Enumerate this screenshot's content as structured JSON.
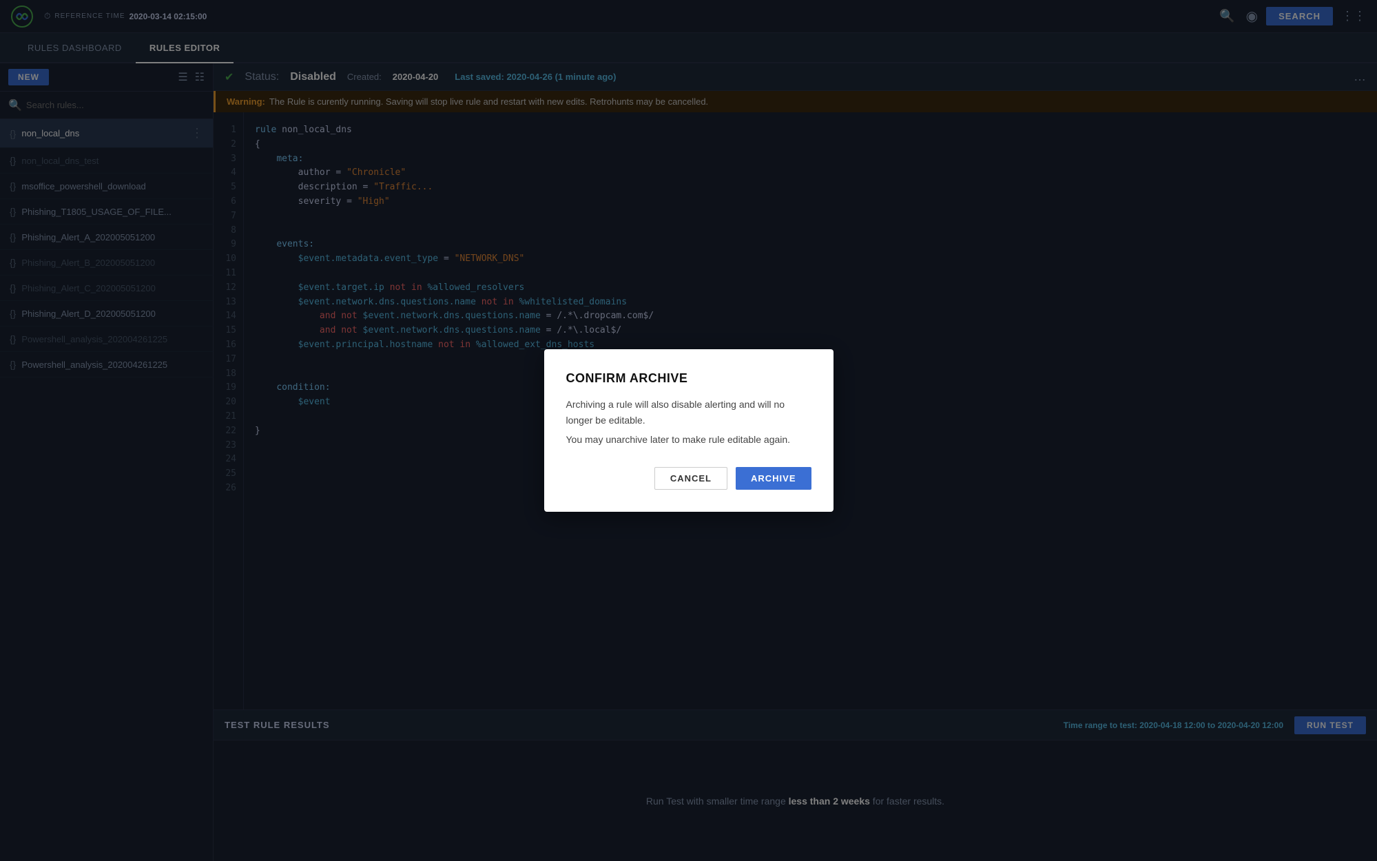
{
  "app": {
    "logo_alt": "Chronicle"
  },
  "topbar": {
    "ref_time_label": "REFERENCE TIME",
    "ref_time_value": "2020-03-14  02:15:00",
    "search_btn_label": "SEARCH"
  },
  "nav": {
    "tabs": [
      {
        "id": "rules-dashboard",
        "label": "RULES DASHBOARD",
        "active": false
      },
      {
        "id": "rules-editor",
        "label": "RULES EDITOR",
        "active": true
      }
    ]
  },
  "sidebar": {
    "new_btn": "NEW",
    "search_placeholder": "Search rules...",
    "rules": [
      {
        "id": "non_local_dns",
        "name": "non_local_dns",
        "active": true,
        "disabled": false,
        "type": "rule"
      },
      {
        "id": "non_local_dns_test",
        "name": "non_local_dns_test",
        "active": false,
        "disabled": true,
        "type": "rule"
      },
      {
        "id": "msoffice_powershell_download",
        "name": "msoffice_powershell_download",
        "active": false,
        "disabled": false,
        "type": "rule"
      },
      {
        "id": "phishing_t1805",
        "name": "Phishing_T1805_USAGE_OF_FILE...",
        "active": false,
        "disabled": false,
        "type": "rule"
      },
      {
        "id": "phishing_a",
        "name": "Phishing_Alert_A_202005051200",
        "active": false,
        "disabled": false,
        "type": "rule"
      },
      {
        "id": "phishing_b",
        "name": "Phishing_Alert_B_202005051200",
        "active": false,
        "disabled": true,
        "type": "rule"
      },
      {
        "id": "phishing_c",
        "name": "Phishing_Alert_C_202005051200",
        "active": false,
        "disabled": true,
        "type": "rule"
      },
      {
        "id": "phishing_d",
        "name": "Phishing_Alert_D_202005051200",
        "active": false,
        "disabled": false,
        "type": "rule"
      },
      {
        "id": "powershell_analysis_225",
        "name": "Powershell_analysis_202004261225",
        "active": false,
        "disabled": true,
        "type": "rule"
      },
      {
        "id": "powershell_analysis",
        "name": "Powershell_analysis_202004261225",
        "active": false,
        "disabled": false,
        "type": "rule"
      }
    ]
  },
  "status_bar": {
    "status_label": "Status:",
    "status_value": "Disabled",
    "created_label": "Created:",
    "created_value": "2020-04-20",
    "last_saved_label": "Last saved:",
    "last_saved_value": "2020-04-26 (1 minute ago)"
  },
  "warning": {
    "label": "Warning:",
    "text": "The Rule is curently running.  Saving will stop  live rule and restart with new edits.  Retrohunts may be cancelled."
  },
  "code": {
    "lines": [
      "rule non_local_dns",
      "{",
      "    meta:",
      "        author = \"Chronicle\"",
      "        description = \"Traffic...",
      "        severity = \"High\"",
      "",
      "",
      "    events:",
      "        $event.metadata.event_type = \"NETWORK_DNS\"",
      "",
      "        $event.target.ip not in %allowed_resolvers",
      "        $event.network.dns.questions.name not in %whitelisted_domains",
      "            and not $event.network.dns.questions.name = /.*\\.dropcam.com$/",
      "            and not $event.network.dns.questions.name = /.*\\.local$/",
      "        $event.principal.hostname not in %allowed_ext_dns_hosts",
      "",
      "",
      "    condition:",
      "        $event",
      "",
      "}",
      "",
      "",
      "",
      ""
    ]
  },
  "bottom_panel": {
    "label": "TEST RULE RESULTS",
    "time_range_label": "Time range to test:",
    "time_range_value": "2020-04-18 12:00 to 2020-04-20 12:00",
    "run_test_btn": "RUN TEST",
    "empty_text_pre": "Run Test with smaller time range ",
    "empty_text_bold": "less than 2 weeks",
    "empty_text_post": " for faster results."
  },
  "dialog": {
    "title": "CONFIRM ARCHIVE",
    "body_line1": "Archiving a rule will also disable alerting  and will no longer be editable.",
    "body_line2": "You may unarchive later to make rule editable again.",
    "cancel_btn": "CANCEL",
    "archive_btn": "ARCHIVE"
  }
}
